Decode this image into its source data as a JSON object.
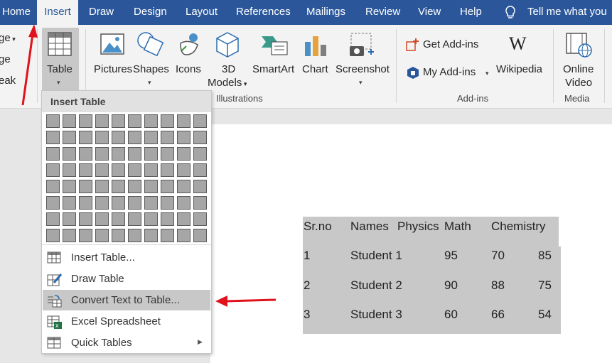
{
  "tabs": [
    {
      "label": "Home",
      "active": false
    },
    {
      "label": "Insert",
      "active": true
    },
    {
      "label": "Draw",
      "active": false
    },
    {
      "label": "Design",
      "active": false
    },
    {
      "label": "Layout",
      "active": false
    },
    {
      "label": "References",
      "active": false
    },
    {
      "label": "Mailings",
      "active": false
    },
    {
      "label": "Review",
      "active": false
    },
    {
      "label": "View",
      "active": false
    },
    {
      "label": "Help",
      "active": false
    }
  ],
  "tell_me": "Tell me what you",
  "pages_group": {
    "items": [
      "ge",
      "ge",
      "eak"
    ]
  },
  "tables_group": {
    "table_label": "Table"
  },
  "illustrations": {
    "pictures": "Pictures",
    "shapes": "Shapes",
    "icons": "Icons",
    "models_line1": "3D",
    "models_line2": "Models",
    "smartart": "SmartArt",
    "chart": "Chart",
    "screenshot": "Screenshot",
    "group_label": "Illustrations"
  },
  "addins": {
    "get": "Get Add-ins",
    "my": "My Add-ins",
    "wikipedia": "Wikipedia",
    "group_label": "Add-ins"
  },
  "media": {
    "line1": "Online",
    "line2": "Video",
    "group_label": "Media"
  },
  "insert_table_menu": {
    "header": "Insert Table",
    "grid_cols": 10,
    "grid_rows": 8,
    "items": [
      {
        "label": "Insert Table...",
        "icon": "table-icon"
      },
      {
        "label": "Draw Table",
        "icon": "draw-table-icon"
      },
      {
        "label": "Convert Text to Table...",
        "icon": "convert-text-icon",
        "highlighted": true
      },
      {
        "label": "Excel Spreadsheet",
        "icon": "excel-icon"
      },
      {
        "label": "Quick Tables",
        "icon": "quick-tables-icon",
        "submenu": true
      }
    ]
  },
  "document_table": {
    "headers": [
      "Sr.no",
      "Names",
      "Physics",
      "Math",
      "Chemistry"
    ],
    "rows": [
      [
        "1",
        "Student 1",
        "95",
        "70",
        "85"
      ],
      [
        "2",
        "Student 2",
        "90",
        "88",
        "75"
      ],
      [
        "3",
        "Student 3",
        "60",
        "66",
        "54"
      ]
    ]
  },
  "colors": {
    "ribbon_blue": "#2b579a",
    "arrow_red": "#e0121b",
    "highlight": "#c8c8c8"
  }
}
